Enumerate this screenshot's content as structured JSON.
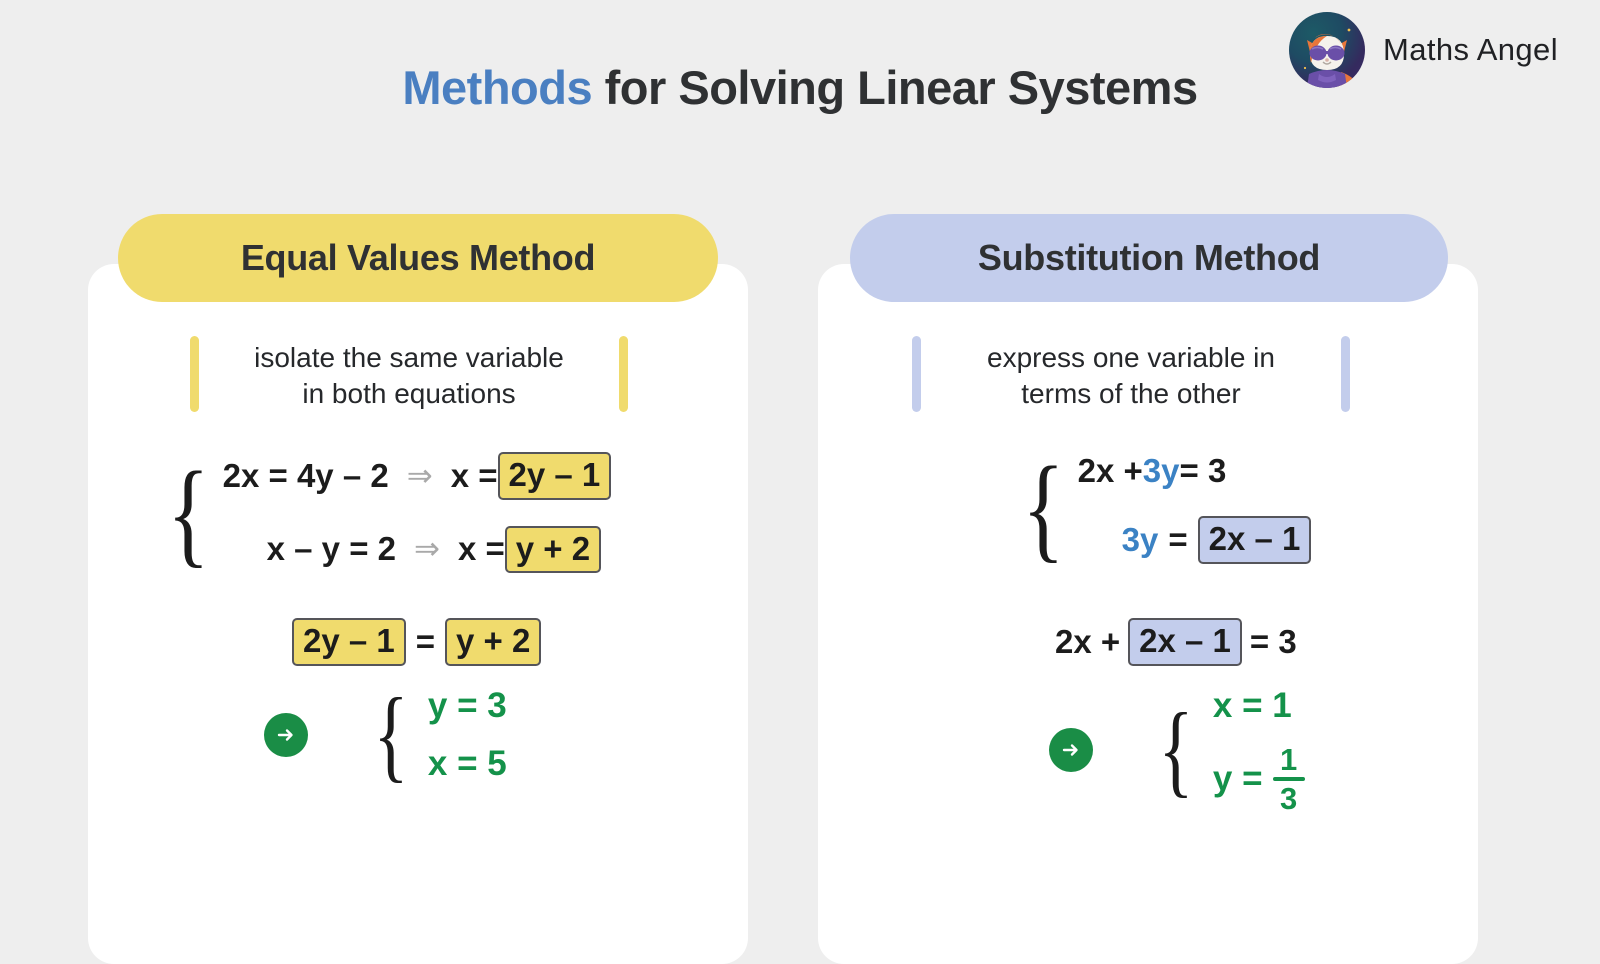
{
  "header": {
    "title_accent": "Methods",
    "title_rest": " for Solving Linear Systems",
    "brand_name": "Maths Angel",
    "logo_icon": "cat-mascot-icon"
  },
  "colors": {
    "background": "#eeeeee",
    "card": "#ffffff",
    "yellow": "#f0db6d",
    "blue": "#c3cdec",
    "accent_blue_text": "#3b82c4",
    "green": "#14924a",
    "arrow_gray": "#a9a9a9",
    "title_dark": "#2f3133"
  },
  "cards": [
    {
      "id": "equal-values",
      "title": "Equal Values Method",
      "description": "isolate the same variable\nin both equations",
      "equations": [
        {
          "lhs": "2x = 4y – 2",
          "arrow": "⇒",
          "rhs_prefix": "x =",
          "boxed": "2y – 1"
        },
        {
          "lhs": "x – y = 2",
          "arrow": "⇒",
          "rhs_prefix": "x =",
          "boxed": "y + 2"
        }
      ],
      "combined": {
        "left_boxed": "2y – 1",
        "operator": "=",
        "right_boxed": "y + 2"
      },
      "solution": {
        "arrow_icon": "arrow-right-icon",
        "lines": [
          "y = 3",
          "x = 5"
        ]
      }
    },
    {
      "id": "substitution",
      "title": "Substitution Method",
      "description": "express one variable in\nterms of the other",
      "equations": [
        {
          "plain_parts": [
            "2x + ",
            "3y",
            " = 3"
          ]
        },
        {
          "lhs_colored": "3y",
          "eq": "=",
          "boxed": "2x – 1"
        }
      ],
      "combined": {
        "prefix": "2x +",
        "boxed": "2x – 1",
        "suffix": "= 3"
      },
      "solution": {
        "arrow_icon": "arrow-right-icon",
        "line1": "x = 1",
        "line2_prefix": "y =",
        "fraction_numerator": "1",
        "fraction_denominator": "3"
      }
    }
  ]
}
